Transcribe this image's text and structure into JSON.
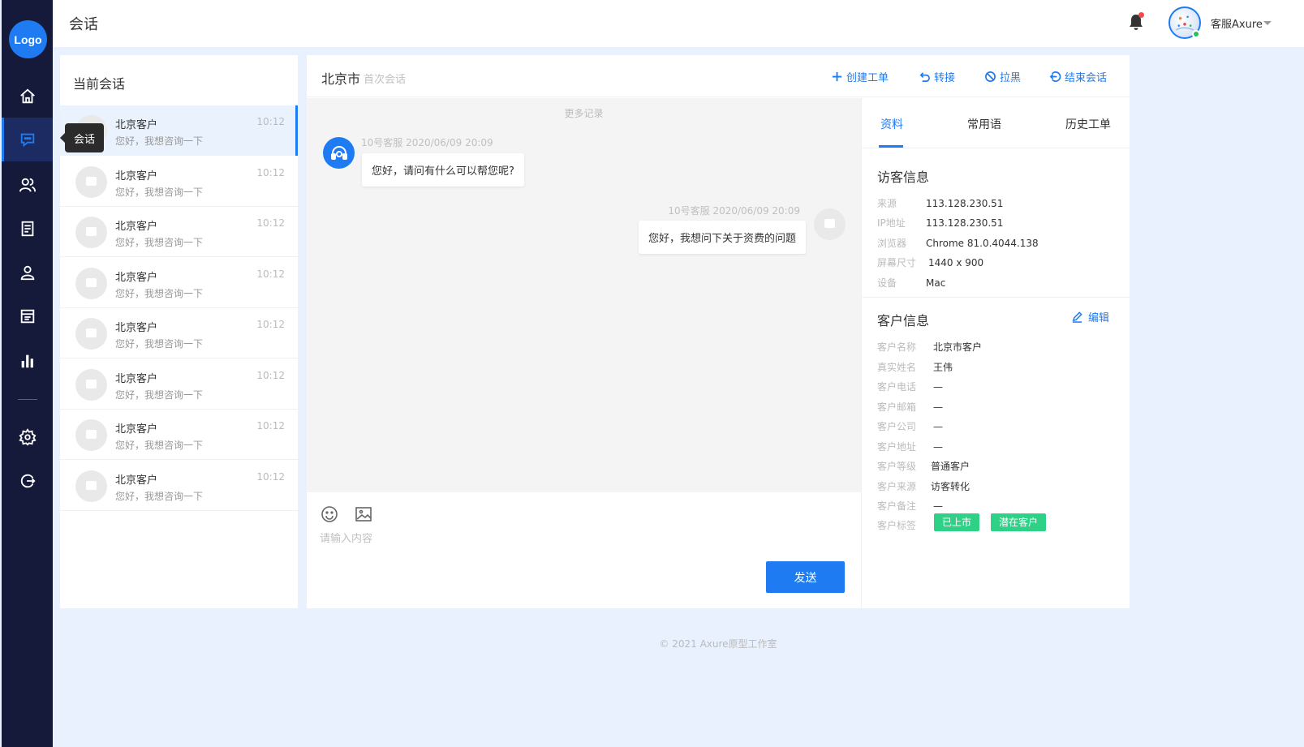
{
  "nav": {
    "logo": "Logo",
    "tooltip": "会话"
  },
  "header": {
    "title": "会话",
    "user_name": "客服Axure"
  },
  "sessions": {
    "title": "当前会话",
    "items": [
      {
        "name": "北京客户",
        "message": "您好，我想咨询一下",
        "time": "10:12"
      },
      {
        "name": "北京客户",
        "message": "您好，我想咨询一下",
        "time": "10:12"
      },
      {
        "name": "北京客户",
        "message": "您好，我想咨询一下",
        "time": "10:12"
      },
      {
        "name": "北京客户",
        "message": "您好，我想咨询一下",
        "time": "10:12"
      },
      {
        "name": "北京客户",
        "message": "您好，我想咨询一下",
        "time": "10:12"
      },
      {
        "name": "北京客户",
        "message": "您好，我想咨询一下",
        "time": "10:12"
      },
      {
        "name": "北京客户",
        "message": "您好，我想咨询一下",
        "time": "10:12"
      },
      {
        "name": "北京客户",
        "message": "您好，我想咨询一下",
        "time": "10:12"
      }
    ]
  },
  "chat": {
    "city": "北京市",
    "subtitle": "首次会话",
    "actions": {
      "create": "创建工单",
      "transfer": "转接",
      "block": "拉黑",
      "end": "结束会话"
    },
    "more_records": "更多记录",
    "messages": [
      {
        "meta": "10号客服 2020/06/09 20:09",
        "text": "您好，请问有什么可以帮您呢?"
      },
      {
        "meta": "10号客服 2020/06/09 20:09",
        "text": "您好，我想问下关于资费的问题"
      }
    ],
    "input_placeholder": "请输入内容",
    "send": "发送"
  },
  "info": {
    "tabs": [
      "资料",
      "常用语",
      "历史工单"
    ],
    "visitor_title": "访客信息",
    "visitor": [
      {
        "k": "来源",
        "v": "113.128.230.51"
      },
      {
        "k": "IP地址",
        "v": "113.128.230.51"
      },
      {
        "k": "浏览器",
        "v": "Chrome 81.0.4044.138"
      },
      {
        "k": "屏幕尺寸",
        "v": "1440 x 900"
      },
      {
        "k": "设备",
        "v": "Mac"
      }
    ],
    "customer_title": "客户信息",
    "edit": "编辑",
    "customer": [
      {
        "k": "客户名称",
        "v": "北京市客户"
      },
      {
        "k": "真实姓名",
        "v": "王伟"
      },
      {
        "k": "客户电话",
        "v": "—"
      },
      {
        "k": "客户邮箱",
        "v": "—"
      },
      {
        "k": "客户公司",
        "v": "—"
      },
      {
        "k": "客户地址",
        "v": "—"
      },
      {
        "k": "客户等级",
        "v": "普通客户"
      },
      {
        "k": "客户来源",
        "v": "访客转化"
      },
      {
        "k": "客户备注",
        "v": "—"
      },
      {
        "k": "客户标签",
        "v": ""
      }
    ],
    "tags": [
      "已上市",
      "潜在客户"
    ]
  },
  "footer": "© 2021 Axure原型工作室",
  "colors": {
    "primary": "#1e7bf2",
    "nav_bg": "#15193a",
    "tag_green": "#2fd186"
  }
}
